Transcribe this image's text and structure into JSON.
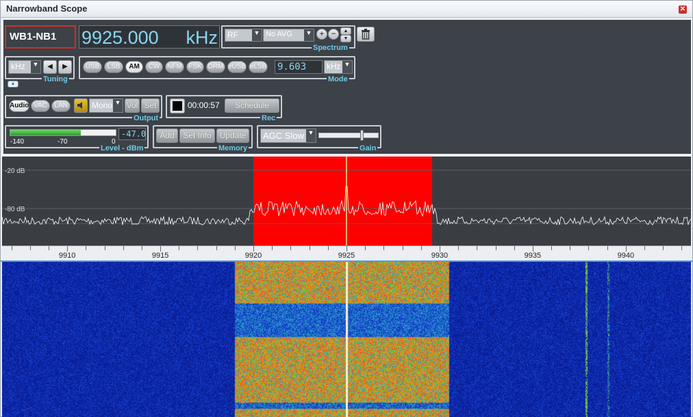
{
  "window": {
    "title": "Narrowband Scope"
  },
  "receiver": {
    "name": "WB1-NB1",
    "frequency": "9925.000",
    "unit": "kHz"
  },
  "spectrum": {
    "source": "RF",
    "avg": "No AVG",
    "label": "Spectrum"
  },
  "tuning": {
    "step_unit": "kHz",
    "label": "Tuning"
  },
  "mode": {
    "buttons": [
      "USB",
      "LSB",
      "AM",
      "CW",
      "NFM",
      "FSK",
      "DRM",
      "eUSB",
      "eLSB"
    ],
    "active": "AM",
    "bandwidth": "9.603",
    "bandwidth_unit": "kHz",
    "label": "Mode"
  },
  "output": {
    "buttons": [
      "Audio",
      "VAC",
      "LAN"
    ],
    "channel": "Mono",
    "vol": "Vol",
    "set": "Set",
    "label": "Output"
  },
  "rec": {
    "time": "00:00:57",
    "schedule": "Schedule",
    "label": "Rec"
  },
  "level": {
    "value": "-47.0",
    "scale": [
      "-140",
      "-70",
      "0"
    ],
    "fill_fraction": 0.67,
    "label": "Level - dBm"
  },
  "memory": {
    "buttons": [
      "Add",
      "Set Info",
      "Update"
    ],
    "label": "Memory"
  },
  "gain": {
    "agc": "AGC Slow",
    "label": "Gain",
    "level_fraction": 0.72
  },
  "spectrum_view": {
    "db_labels": [
      "-20 dB",
      "-80 dB"
    ],
    "freq_min": 9906.5,
    "freq_max": 9943.5,
    "passband": [
      9920,
      9929.6
    ],
    "center": 9925,
    "ticks": [
      "9910",
      "9915",
      "9920",
      "9925",
      "9930",
      "9935",
      "9940"
    ],
    "colors": {
      "passband": "#ff0000",
      "trace": "#ffffff",
      "center": "#ffe98a"
    }
  }
}
